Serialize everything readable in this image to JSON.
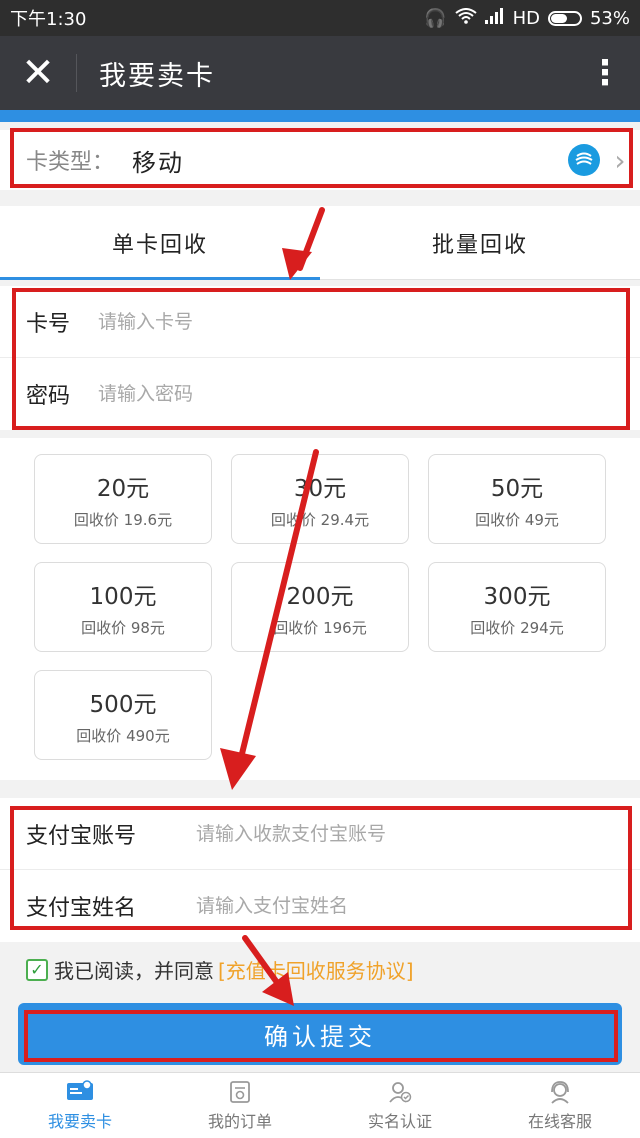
{
  "status_bar": {
    "time": "下午1:30",
    "network": "HD",
    "battery_text": "53%",
    "battery_level": 0.53
  },
  "header": {
    "title": "我要卖卡",
    "close_icon": "close-icon",
    "more_icon": "more-vert-icon"
  },
  "card_type": {
    "label": "卡类型：",
    "value": "移动",
    "brand_icon": "china-mobile-icon"
  },
  "tabs": [
    {
      "label": "单卡回收",
      "active": true
    },
    {
      "label": "批量回收",
      "active": false
    }
  ],
  "card_fields": {
    "card_number": {
      "label": "卡号",
      "placeholder": "请输入卡号"
    },
    "password": {
      "label": "密码",
      "placeholder": "请输入密码"
    }
  },
  "denominations": [
    {
      "amount": "20元",
      "price": "回收价 19.6元"
    },
    {
      "amount": "30元",
      "price": "回收价 29.4元"
    },
    {
      "amount": "50元",
      "price": "回收价 49元"
    },
    {
      "amount": "100元",
      "price": "回收价 98元"
    },
    {
      "amount": "200元",
      "price": "回收价 196元"
    },
    {
      "amount": "300元",
      "price": "回收价 294元"
    },
    {
      "amount": "500元",
      "price": "回收价 490元"
    }
  ],
  "alipay_fields": {
    "account": {
      "label": "支付宝账号",
      "placeholder": "请输入收款支付宝账号"
    },
    "name": {
      "label": "支付宝姓名",
      "placeholder": "请输入支付宝姓名"
    }
  },
  "agreement": {
    "checked": true,
    "text": "我已阅读，并同意",
    "link": "[充值卡回收服务协议]"
  },
  "submit_label": "确认提交",
  "bottom_nav": [
    {
      "label": "我要卖卡",
      "icon": "card-icon",
      "active": true
    },
    {
      "label": "我的订单",
      "icon": "order-icon",
      "active": false
    },
    {
      "label": "实名认证",
      "icon": "verify-icon",
      "active": false
    },
    {
      "label": "在线客服",
      "icon": "support-icon",
      "active": false
    }
  ],
  "colors": {
    "accent": "#2e8fe2",
    "annotation_red": "#d81e1e",
    "link_orange": "#f0a22a"
  }
}
